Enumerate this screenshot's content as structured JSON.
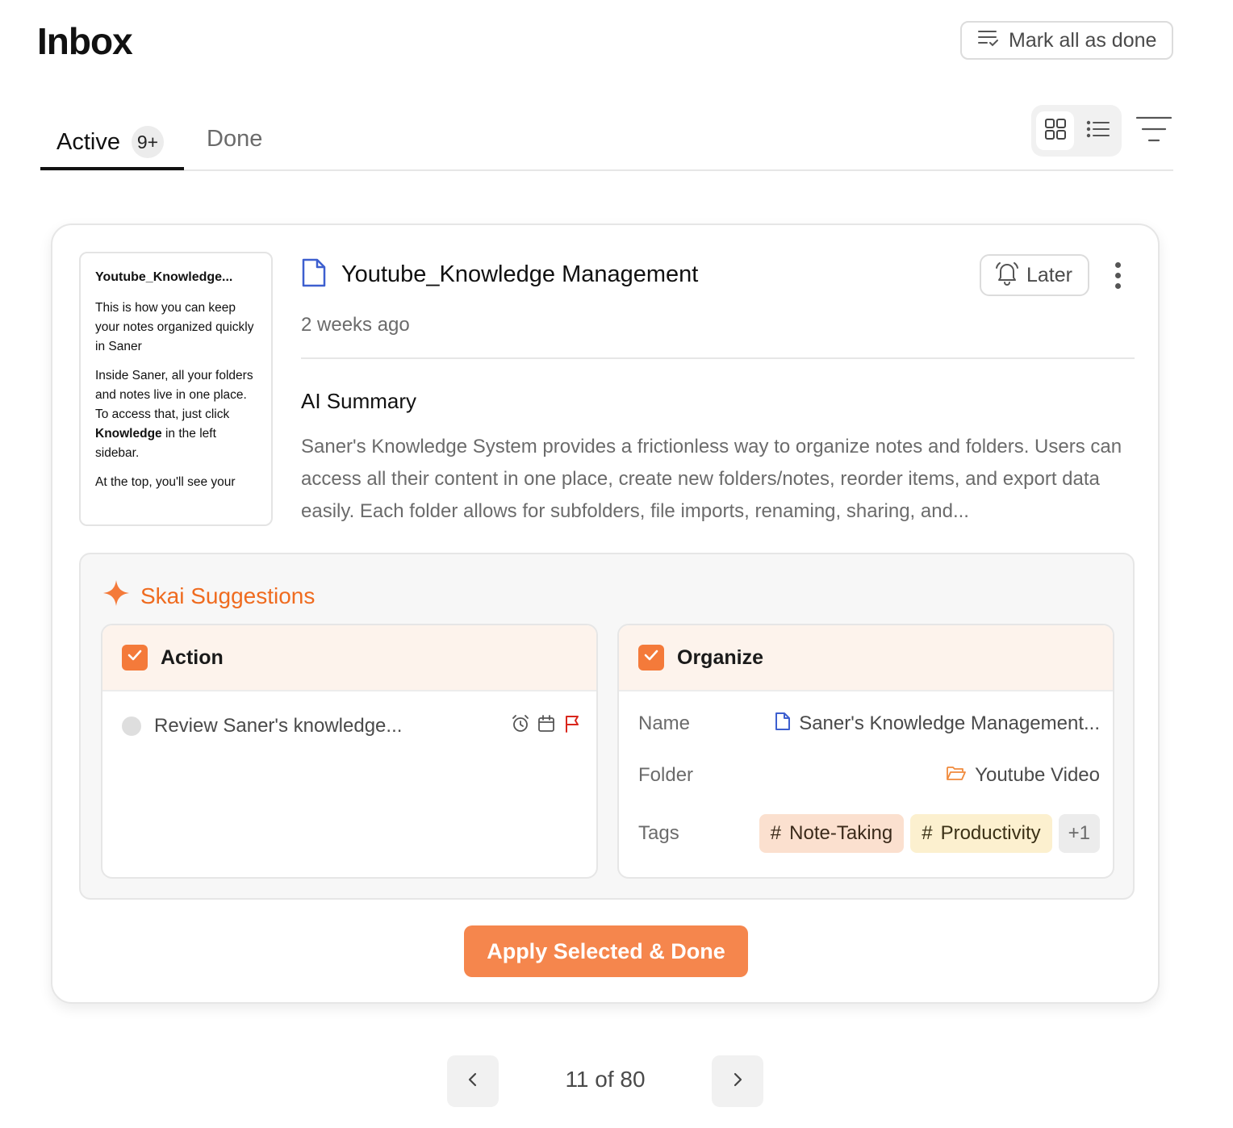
{
  "header": {
    "title": "Inbox",
    "mark_all_label": "Mark all as done"
  },
  "tabs": [
    {
      "label": "Active",
      "badge": "9+",
      "active": true
    },
    {
      "label": "Done",
      "active": false
    }
  ],
  "view": {
    "modes": [
      "grid-icon",
      "list-icon"
    ],
    "selected": "grid"
  },
  "item": {
    "preview": {
      "title": "Youtube_Knowledge...",
      "p1": "This is how you can keep your notes organized quickly in Saner",
      "p2": "Inside Saner, all your folders and notes live in one place.",
      "p3a": "To access that, just click ",
      "p3b": "Knowledge",
      "p3c": " in the left sidebar.",
      "p4": "At the top, you'll see your"
    },
    "title": "Youtube_Knowledge Management",
    "time": "2 weeks ago",
    "later_label": "Later",
    "ai_summary_label": "AI Summary",
    "ai_summary_text": "Saner's Knowledge System provides a frictionless way to organize notes and folders. Users can access all their content in one place, create new folders/notes, reorder items, and export data easily. Each folder allows for subfolders, file imports, renaming, sharing, and..."
  },
  "suggestions": {
    "title": "Skai Suggestions",
    "action": {
      "label": "Action",
      "checked": true,
      "task": "Review Saner's knowledge...",
      "flag_color": "#d9261c"
    },
    "organize": {
      "label": "Organize",
      "checked": true,
      "name_label": "Name",
      "name_value": "Saner's Knowledge Management...",
      "folder_label": "Folder",
      "folder_value": "Youtube Video",
      "tags_label": "Tags",
      "tags": [
        "Note-Taking",
        "Productivity"
      ],
      "tags_more": "+1"
    },
    "apply_label": "Apply Selected & Done"
  },
  "pagination": {
    "text": "11 of 80",
    "current": 11,
    "total": 80
  },
  "colors": {
    "accent": "#f47a3a",
    "doc_icon": "#3d5fcf",
    "folder_icon": "#f08a3c"
  }
}
